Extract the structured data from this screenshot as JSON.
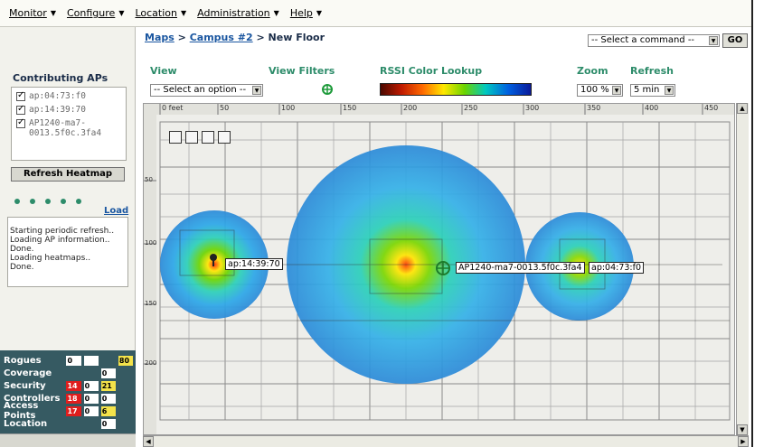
{
  "menubar": {
    "items": [
      {
        "label": "Monitor"
      },
      {
        "label": "Configure"
      },
      {
        "label": "Location"
      },
      {
        "label": "Administration"
      },
      {
        "label": "Help"
      }
    ]
  },
  "left": {
    "contributing_title": "Contributing APs",
    "aps": [
      {
        "label": "ap:04:73:f0",
        "checked": true
      },
      {
        "label": "ap:14:39:70",
        "checked": true
      },
      {
        "label": "AP1240-ma7-0013.5f0c.3fa4",
        "checked": true
      }
    ],
    "refresh_button": "Refresh Heatmap",
    "load_link": "Load",
    "log": [
      "Starting periodic refresh..",
      "Loading AP information..",
      "Done.",
      "Loading heatmaps..",
      "Done."
    ]
  },
  "status": {
    "rows": [
      {
        "label": "Rogues",
        "cells": [
          {
            "v": "0",
            "c": "white"
          },
          {
            "v": "",
            "c": "white"
          },
          {
            "v": "",
            "c": "empty"
          },
          {
            "v": "80",
            "c": "yellow"
          }
        ]
      },
      {
        "label": "Coverage",
        "cells": [
          {
            "v": "",
            "c": "empty"
          },
          {
            "v": "",
            "c": "empty"
          },
          {
            "v": "0",
            "c": "white"
          },
          {
            "v": "",
            "c": "empty"
          }
        ]
      },
      {
        "label": "Security",
        "cells": [
          {
            "v": "14",
            "c": "red"
          },
          {
            "v": "0",
            "c": "white"
          },
          {
            "v": "21",
            "c": "yellow"
          },
          {
            "v": "",
            "c": "empty"
          }
        ]
      },
      {
        "label": "Controllers",
        "cells": [
          {
            "v": "18",
            "c": "red"
          },
          {
            "v": "0",
            "c": "white"
          },
          {
            "v": "0",
            "c": "white"
          },
          {
            "v": "",
            "c": "empty"
          }
        ]
      },
      {
        "label": "Access Points",
        "cells": [
          {
            "v": "17",
            "c": "red"
          },
          {
            "v": "0",
            "c": "white"
          },
          {
            "v": "6",
            "c": "yellow"
          },
          {
            "v": "",
            "c": "empty"
          }
        ]
      },
      {
        "label": "Location",
        "cells": [
          {
            "v": "",
            "c": "empty"
          },
          {
            "v": "",
            "c": "empty"
          },
          {
            "v": "0",
            "c": "white"
          },
          {
            "v": "",
            "c": "empty"
          }
        ]
      }
    ]
  },
  "main": {
    "breadcrumb": {
      "maps": "Maps",
      "sep1": ">",
      "campus": "Campus #2",
      "sep2": ">",
      "current": "New Floor"
    },
    "command_select": "-- Select a command --",
    "go_button": "GO",
    "view_label": "View",
    "view_select": "-- Select an option --",
    "filters_label": "View Filters",
    "rssi_label": "RSSI Color Lookup",
    "zoom_label": "Zoom",
    "zoom_value": "100 %",
    "refresh_label": "Refresh",
    "refresh_value": "5 min"
  },
  "map": {
    "ruler_top": [
      "0 feet",
      "50",
      "100",
      "150",
      "200",
      "250",
      "300",
      "350",
      "400",
      "450"
    ],
    "ruler_left": [
      "50",
      "100",
      "150",
      "200"
    ],
    "ap_tags": [
      "ap:14:39:70",
      "AP1240-ma7-0013.5f0c.3fa4",
      "ap:04:73:f0"
    ],
    "toolbar_icons": [
      "save-icon",
      "print-icon",
      "email-icon",
      "export-icon"
    ]
  }
}
